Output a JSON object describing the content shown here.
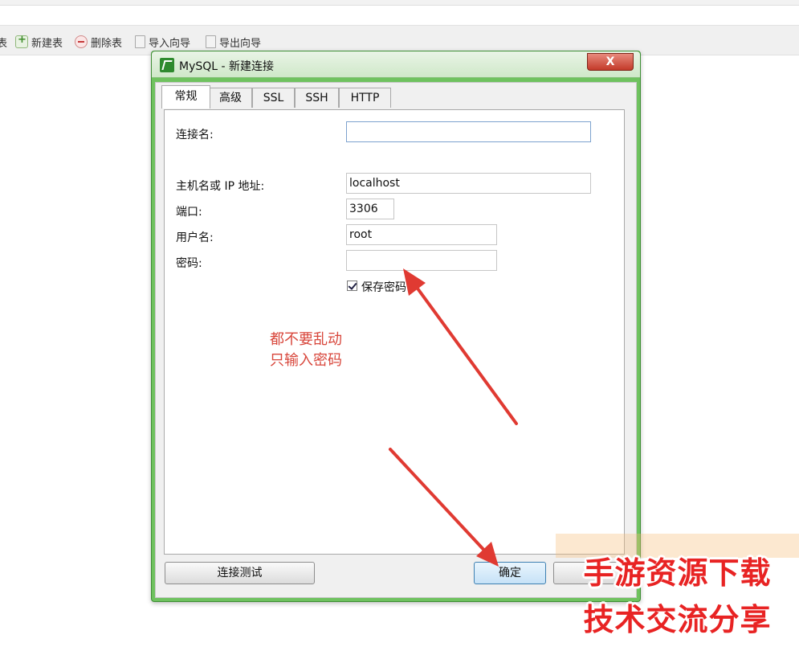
{
  "toolbar": {
    "items": [
      {
        "label": "表",
        "icon": "table-icon"
      },
      {
        "label": "新建表",
        "icon": "new-table-icon"
      },
      {
        "label": "删除表",
        "icon": "delete-table-icon"
      },
      {
        "label": "导入向导",
        "icon": "import-wizard-icon"
      },
      {
        "label": "导出向导",
        "icon": "export-wizard-icon"
      }
    ]
  },
  "dialog": {
    "title": "MySQL - 新建连接",
    "close_label": "X",
    "tabs": [
      "常规",
      "高级",
      "SSL",
      "SSH",
      "HTTP"
    ],
    "active_tab": "常规",
    "fields": {
      "connection_name": {
        "label": "连接名:",
        "value": ""
      },
      "host": {
        "label": "主机名或 IP 地址:",
        "value": "localhost"
      },
      "port": {
        "label": "端口:",
        "value": "3306"
      },
      "username": {
        "label": "用户名:",
        "value": "root"
      },
      "password": {
        "label": "密码:",
        "value": ""
      }
    },
    "save_password": {
      "label": "保存密码",
      "checked": true
    },
    "buttons": {
      "test": "连接测试",
      "ok": "确定"
    }
  },
  "annotation": {
    "line1": "都不要乱动",
    "line2": "只输入密码",
    "color": "#d8463b"
  },
  "watermark": {
    "line1": "手游资源下载",
    "line2": "技术交流分享",
    "color": "#e82323"
  }
}
